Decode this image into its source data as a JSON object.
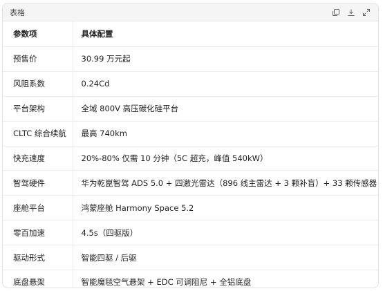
{
  "panel": {
    "title": "表格",
    "icons": [
      "copy-icon",
      "download-icon",
      "expand-icon"
    ]
  },
  "table": {
    "headers": [
      "参数项",
      "具体配置"
    ],
    "rows": [
      [
        "预售价",
        "30.99 万元起"
      ],
      [
        "风阻系数",
        "0.24Cd"
      ],
      [
        "平台架构",
        "全域 800V 高压碳化硅平台"
      ],
      [
        "CLTC 综合续航",
        "最高 740km"
      ],
      [
        "快充速度",
        "20%-80% 仅需 10 分钟（5C 超充，峰值 540kW）"
      ],
      [
        "智驾硬件",
        "华为乾崑智驾 ADS 5.0 + 四激光雷达（896 线主雷达 + 3 颗补盲）+ 33 颗传感器"
      ],
      [
        "座舱平台",
        "鸿蒙座舱 Harmony Space 5.2"
      ],
      [
        "零百加速",
        "4.5s（四驱版）"
      ],
      [
        "驱动形式",
        "智能四驱 / 后驱"
      ],
      [
        "底盘悬架",
        "智能魔毯空气悬架 + EDC 可调阻尼 + 全铝底盘"
      ]
    ]
  }
}
